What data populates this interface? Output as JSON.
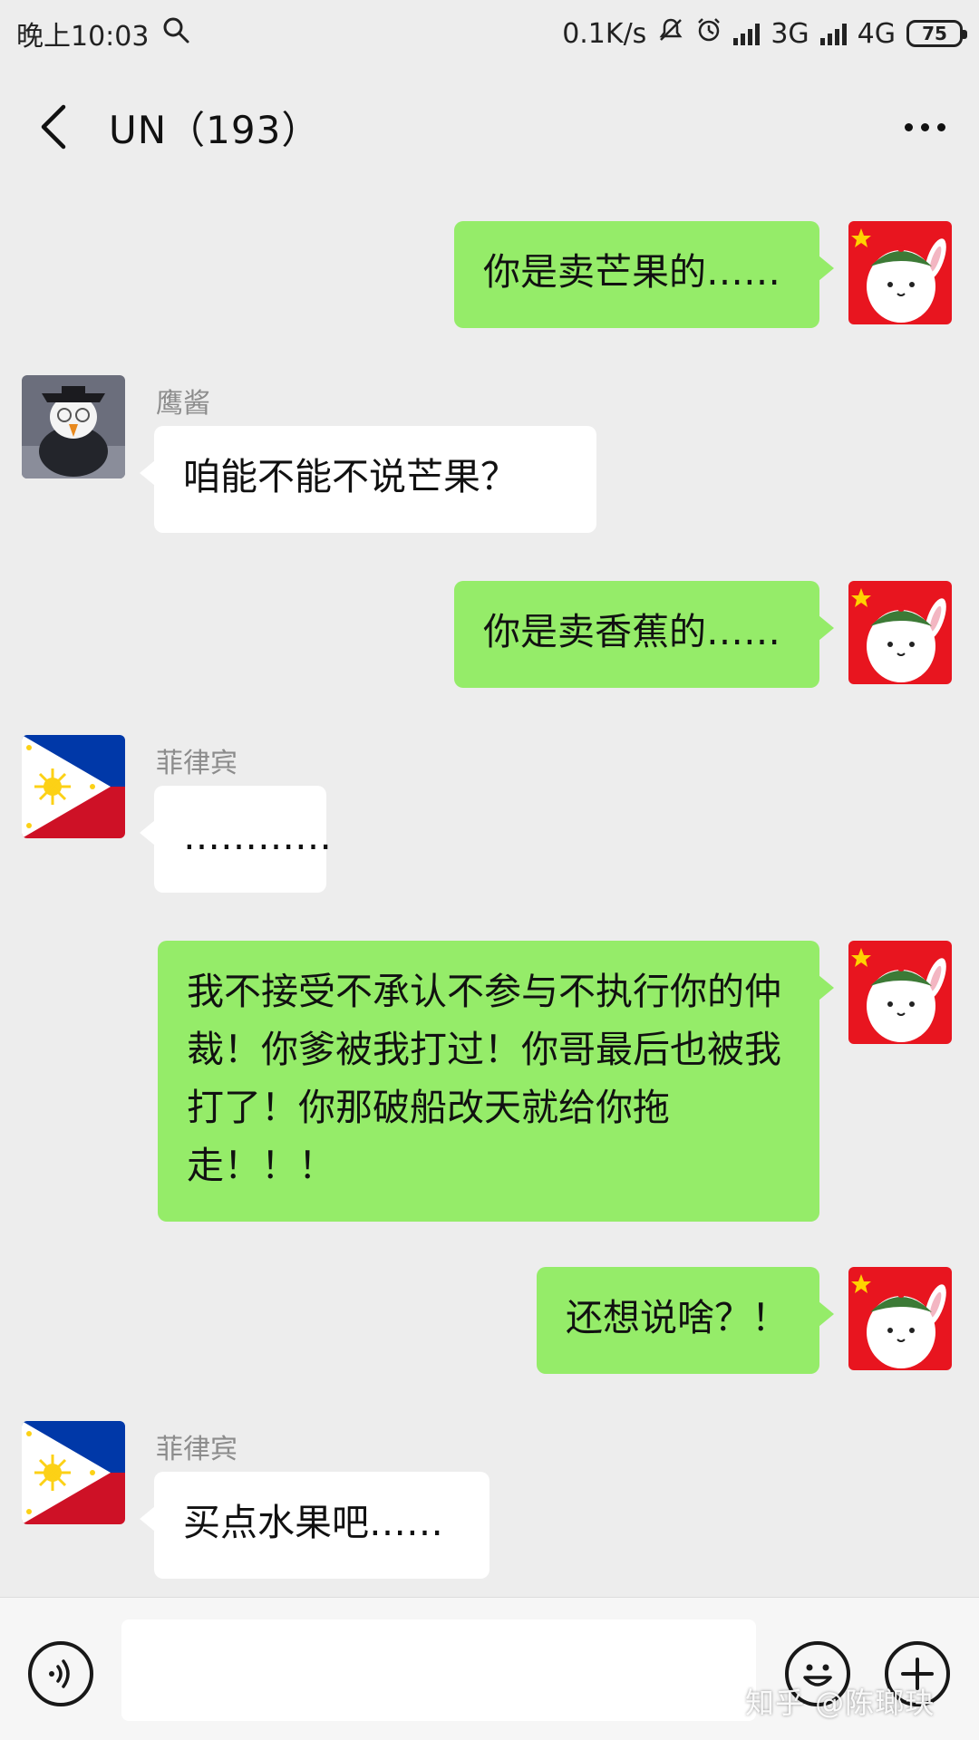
{
  "status_bar": {
    "time": "晚上10:03",
    "speed": "0.1K/s",
    "net1": "3G",
    "net2": "4G",
    "battery": "75"
  },
  "header": {
    "title": "UN（193）"
  },
  "messages": [
    {
      "side": "right",
      "text": "你是卖芒果的……"
    },
    {
      "side": "left",
      "sender": "鹰酱",
      "text": "咱能不能不说芒果？"
    },
    {
      "side": "right",
      "text": "你是卖香蕉的……"
    },
    {
      "side": "left",
      "sender": "菲律宾",
      "text": "…………"
    },
    {
      "side": "right",
      "text": "我不接受不承认不参与不执行你的仲裁！你爹被我打过！你哥最后也被我打了！你那破船改天就给你拖走！！！"
    },
    {
      "side": "right",
      "text": "还想说啥？！"
    },
    {
      "side": "left",
      "sender": "菲律宾",
      "text": "买点水果吧……"
    }
  ],
  "input": {
    "value": "",
    "placeholder": ""
  },
  "watermark": "知乎 @陈瑯玦",
  "colors": {
    "background": "#ededed",
    "bubble_self": "#95ec69",
    "bubble_other": "#ffffff"
  },
  "icons": [
    "search-icon",
    "mute-icon",
    "alarm-icon",
    "back-icon",
    "more-icon",
    "voice-icon",
    "emoji-icon",
    "plus-icon"
  ]
}
